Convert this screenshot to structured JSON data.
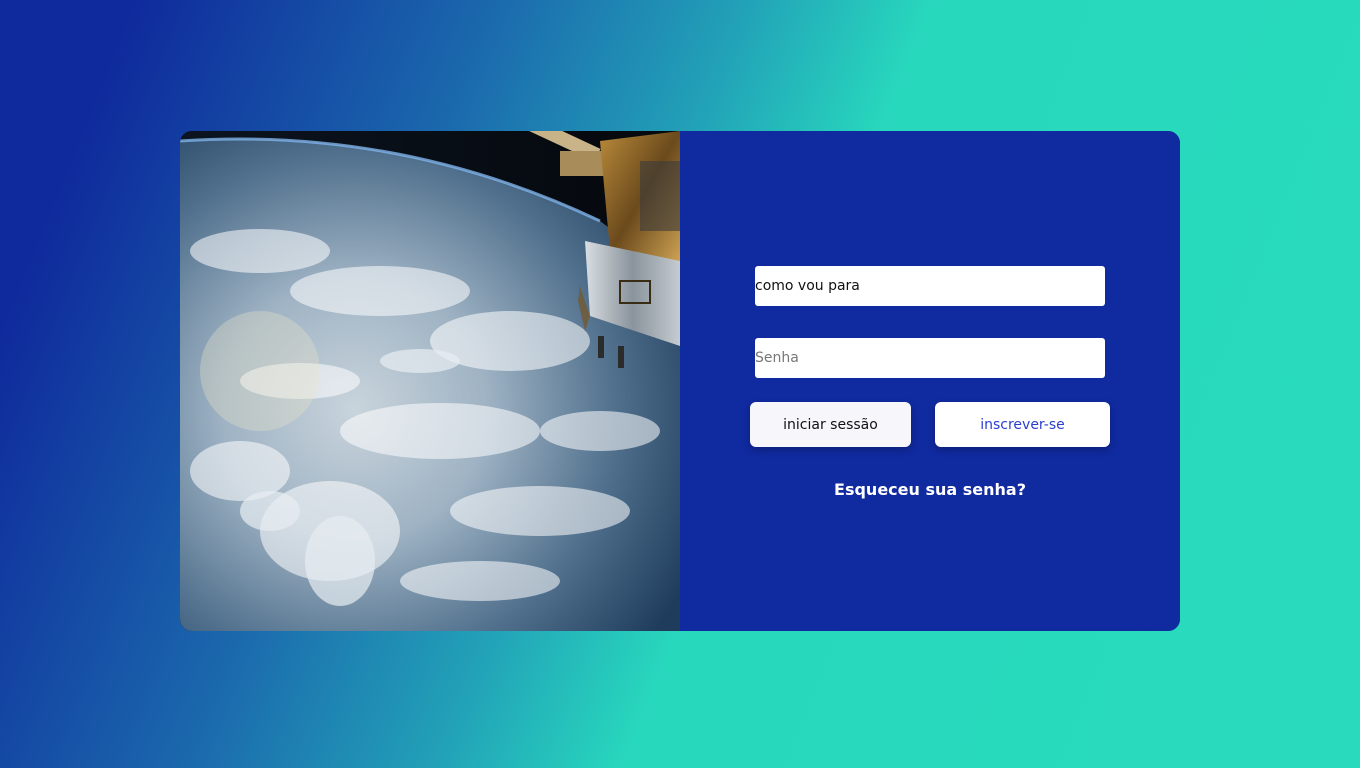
{
  "login": {
    "username_value": "como vou para",
    "password_placeholder": "Senha",
    "login_button_label": "iniciar sessão",
    "signup_button_label": "inscrever-se",
    "forgot_password_label": "Esqueceu sua senha?"
  },
  "image": {
    "icon": "earth-from-space-photo"
  },
  "colors": {
    "panel": "#102aa0",
    "gradient_start": "#0f2a9c",
    "gradient_end": "#29dbbc",
    "signup_text": "#2b3fcf"
  }
}
